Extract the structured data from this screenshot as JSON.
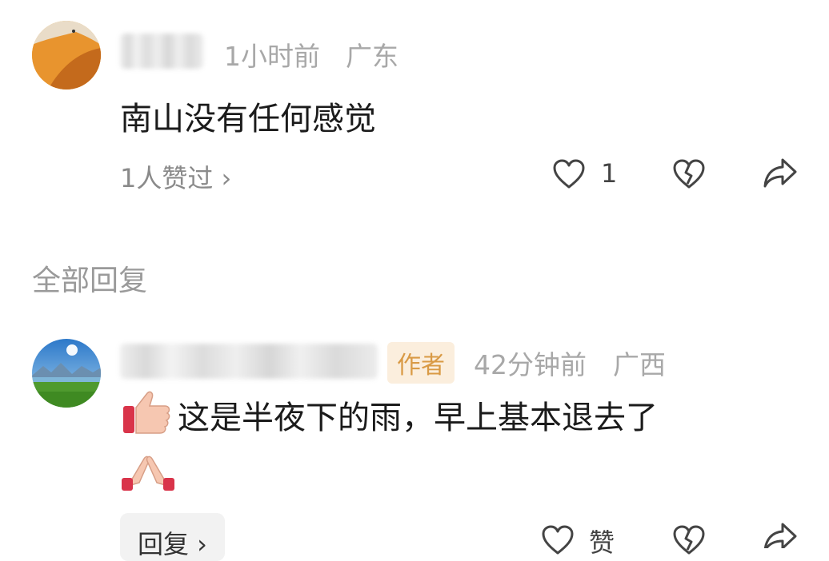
{
  "comment1": {
    "time": "1小时前",
    "location": "广东",
    "text": "南山没有任何感觉",
    "likes_summary": "1人赞过 ›",
    "like_count": "1"
  },
  "section": {
    "title": "全部回复"
  },
  "comment2": {
    "badge": "作者",
    "time": "42分钟前",
    "location": "广西",
    "text": "这是半夜下的雨，早上基本退去了",
    "reply_button": "回复 ›",
    "like_label": "赞"
  },
  "icons": {
    "like": "heart-outline-icon",
    "dislike": "broken-heart-icon",
    "share": "share-arrow-icon",
    "thumbs_up": "thumbs-up-emoji-icon",
    "clap": "pressed-hands-emoji-icon"
  }
}
